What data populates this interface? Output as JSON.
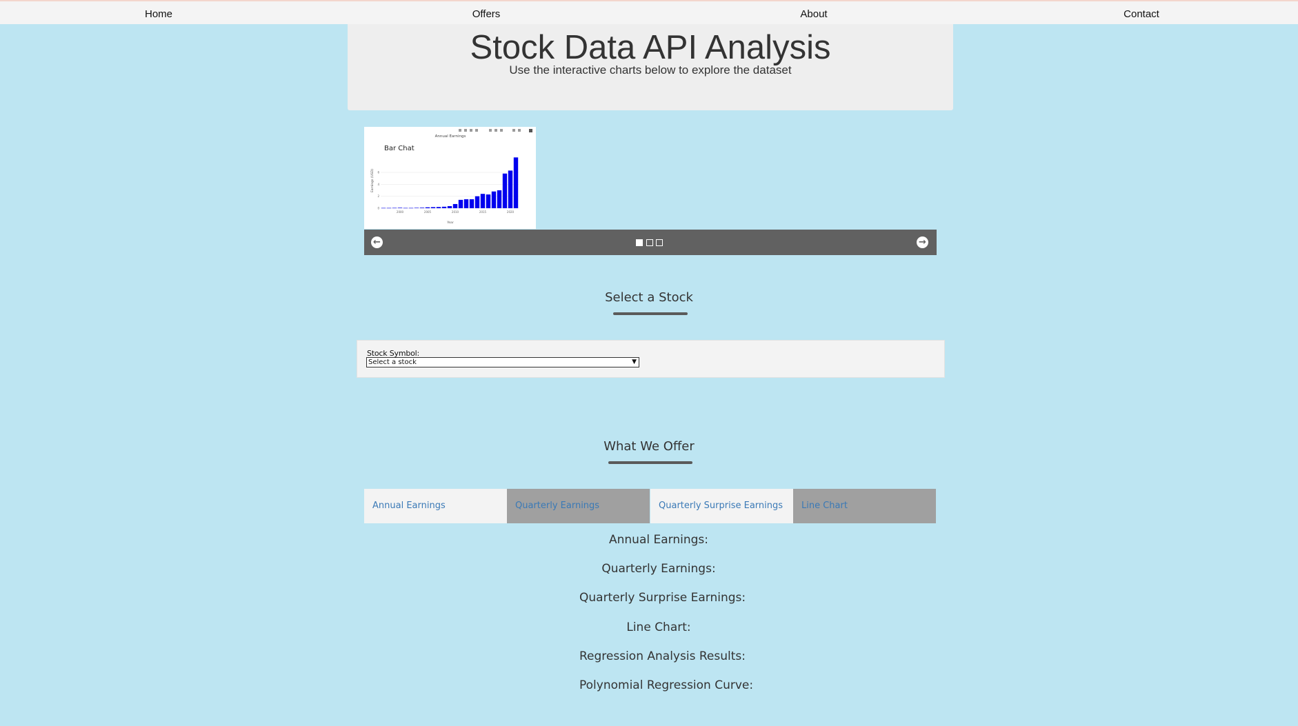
{
  "nav": {
    "items": [
      {
        "label": "Home"
      },
      {
        "label": "Offers"
      },
      {
        "label": "About"
      },
      {
        "label": "Contact"
      }
    ]
  },
  "header": {
    "title": "Stock Data API Analysis",
    "subtitle": "Use the interactive charts below to explore the dataset"
  },
  "carousel": {
    "slide_label": "Bar Chat",
    "prev_icon": "arrow-left-circle-icon",
    "next_icon": "arrow-right-circle-icon",
    "slide_count": 3,
    "active_index": 0
  },
  "chart_data": {
    "type": "bar",
    "title": "Annual Earnings",
    "xlabel": "Year",
    "ylabel": "Earnings (USD)",
    "x": [
      1997,
      1998,
      1999,
      2000,
      2001,
      2002,
      2003,
      2004,
      2005,
      2006,
      2007,
      2008,
      2009,
      2010,
      2011,
      2012,
      2013,
      2014,
      2015,
      2016,
      2017,
      2018,
      2019,
      2020,
      2021
    ],
    "values": [
      0.05,
      0.05,
      0.06,
      0.08,
      0.05,
      0.05,
      0.07,
      0.09,
      0.15,
      0.18,
      0.2,
      0.25,
      0.35,
      0.7,
      1.4,
      1.5,
      1.5,
      2.0,
      2.4,
      2.3,
      2.8,
      3.0,
      5.8,
      6.3,
      8.5
    ],
    "xticks": [
      "2000",
      "2005",
      "2010",
      "2015",
      "2020"
    ],
    "yticks": [
      "0",
      "2",
      "4",
      "6"
    ],
    "ylim": [
      0,
      9
    ],
    "bar_color": "#0000ee",
    "grid": true
  },
  "select_section": {
    "title": "Select a Stock",
    "field_label": "Stock Symbol:",
    "selected_value": "Select a stock"
  },
  "offer_section": {
    "title": "What We Offer",
    "tabs": [
      {
        "label": "Annual Earnings"
      },
      {
        "label": "Quarterly Earnings"
      },
      {
        "label": "Quarterly Surprise Earnings"
      },
      {
        "label": "Line Chart"
      }
    ]
  },
  "results": [
    "Annual Earnings:",
    "Quarterly Earnings:",
    "Quarterly Surprise Earnings:",
    "Line Chart:",
    "Regression Analysis Results:",
    "Polynomial Regression Curve:"
  ],
  "colors": {
    "background": "#bde5f2",
    "carousel_bar": "#616161",
    "link": "#3a79b6"
  }
}
